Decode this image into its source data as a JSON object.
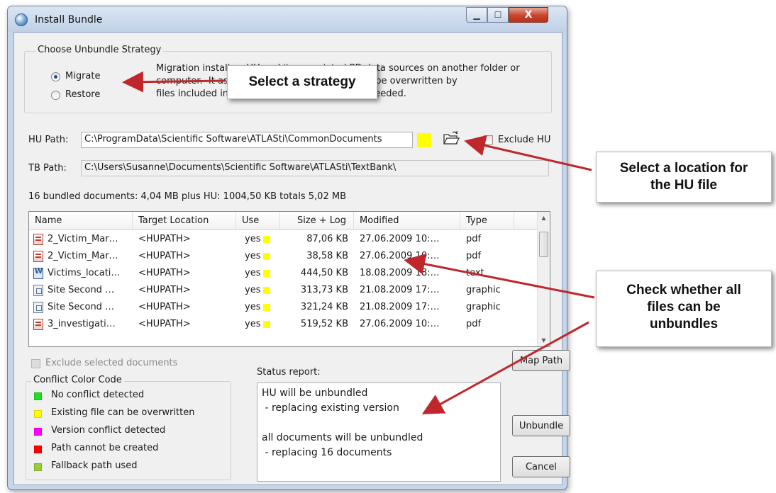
{
  "window": {
    "title": "Install Bundle",
    "controls": {
      "minimize": "▁",
      "maximize": "☐",
      "close": "X"
    }
  },
  "strategy": {
    "group_label": "Choose Unbundle Strategy",
    "options": [
      {
        "label": "Migrate",
        "checked": true
      },
      {
        "label": "Restore",
        "checked": false
      }
    ],
    "description_lines": [
      "Migration installs a HU and its associated PD data sources on another folder or",
      "computer.  It as                              s should not be overwritten by",
      "files included in                             e created if needed."
    ]
  },
  "hu_path": {
    "label": "HU Path:",
    "value": "C:\\ProgramData\\Scientific Software\\ATLASti\\CommonDocuments",
    "status_color": "#ffff00",
    "browse_icon": "open-folder-icon",
    "exclude_label": "Exclude HU",
    "exclude_checked": false
  },
  "tb_path": {
    "label": "TB Path:",
    "value": "C:\\Users\\Susanne\\Documents\\Scientific Software\\ATLASti\\TextBank\\"
  },
  "summary": "16 bundled documents: 4,04 MB plus HU: 1004,50 KB totals 5,02 MB",
  "documents": {
    "columns": [
      "Name",
      "Target Location",
      "Use",
      "Size + Log",
      "Modified",
      "Type"
    ],
    "rows": [
      {
        "icon": "pdf",
        "name": "2_Victim_Mar…",
        "target": "<HUPATH>",
        "use": "yes",
        "size": "87,06 KB",
        "modified": "27.06.2009 10:…",
        "type": "pdf"
      },
      {
        "icon": "pdf",
        "name": "2_Victim_Mar…",
        "target": "<HUPATH>",
        "use": "yes",
        "size": "38,58 KB",
        "modified": "27.06.2009 10:…",
        "type": "pdf"
      },
      {
        "icon": "text",
        "name": "Victims_locati…",
        "target": "<HUPATH>",
        "use": "yes",
        "size": "444,50 KB",
        "modified": "18.08.2009 18:…",
        "type": "text"
      },
      {
        "icon": "graphic",
        "name": "Site Second …",
        "target": "<HUPATH>",
        "use": "yes",
        "size": "313,73 KB",
        "modified": "21.08.2009 17:…",
        "type": "graphic"
      },
      {
        "icon": "graphic",
        "name": "Site Second …",
        "target": "<HUPATH>",
        "use": "yes",
        "size": "321,24 KB",
        "modified": "21.08.2009 17:…",
        "type": "graphic"
      },
      {
        "icon": "pdf",
        "name": "3_investigati…",
        "target": "<HUPATH>",
        "use": "yes",
        "size": "519,52 KB",
        "modified": "27.06.2009 10:…",
        "type": "pdf"
      }
    ],
    "use_color": "#ffff00"
  },
  "exclude_selected": {
    "label": "Exclude selected documents",
    "checked": false,
    "disabled": true
  },
  "conflict_legend": {
    "label": "Conflict Color Code",
    "items": [
      {
        "label": "No conflict detected",
        "color": "#22dd22"
      },
      {
        "label": "Existing file can be overwritten",
        "color": "#ffff00"
      },
      {
        "label": "Version conflict detected",
        "color": "#ff00ff"
      },
      {
        "label": "Path cannot be created",
        "color": "#ff0000"
      },
      {
        "label": "Fallback path used",
        "color": "#9acd32"
      }
    ]
  },
  "status": {
    "label": "Status report:",
    "lines": [
      "HU will be unbundled",
      " - replacing existing version",
      "",
      "all documents will be unbundled",
      " - replacing 16 documents"
    ]
  },
  "buttons": {
    "map_path": "Map Path",
    "unbundle": "Unbundle",
    "cancel": "Cancel"
  },
  "callouts": {
    "strategy": [
      "Select a strategy"
    ],
    "location": [
      "Select a location for",
      "the HU file"
    ],
    "check": [
      "Check whether all",
      "files can be",
      "unbundles"
    ],
    "arrow_color": "#c0272d"
  }
}
